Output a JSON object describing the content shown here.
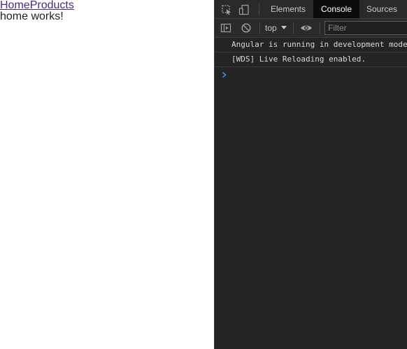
{
  "page": {
    "nav_links": [
      {
        "label": "Home"
      },
      {
        "label": "Products"
      }
    ],
    "content_text": "home works!"
  },
  "devtools": {
    "icons": {
      "inspect": "inspect-element-icon",
      "device": "device-toolbar-icon",
      "sidebar": "show-sidebar-icon",
      "clear": "clear-console-icon",
      "eye": "live-expression-icon",
      "prompt": "console-prompt-icon"
    },
    "tabs": [
      {
        "label": "Elements",
        "active": false
      },
      {
        "label": "Console",
        "active": true
      },
      {
        "label": "Sources",
        "active": false
      }
    ],
    "toolbar": {
      "context": "top",
      "filter_placeholder": "Filter"
    },
    "console_messages": [
      {
        "text": "Angular is running in development mode. Call enableProdMode() to enable production mode."
      },
      {
        "text": "[WDS] Live Reloading enabled."
      }
    ],
    "colors": {
      "background": "#242424",
      "active_tab_bg": "#0c0c0c",
      "link": "#4b2a83",
      "prompt": "#3d8cf0"
    }
  }
}
